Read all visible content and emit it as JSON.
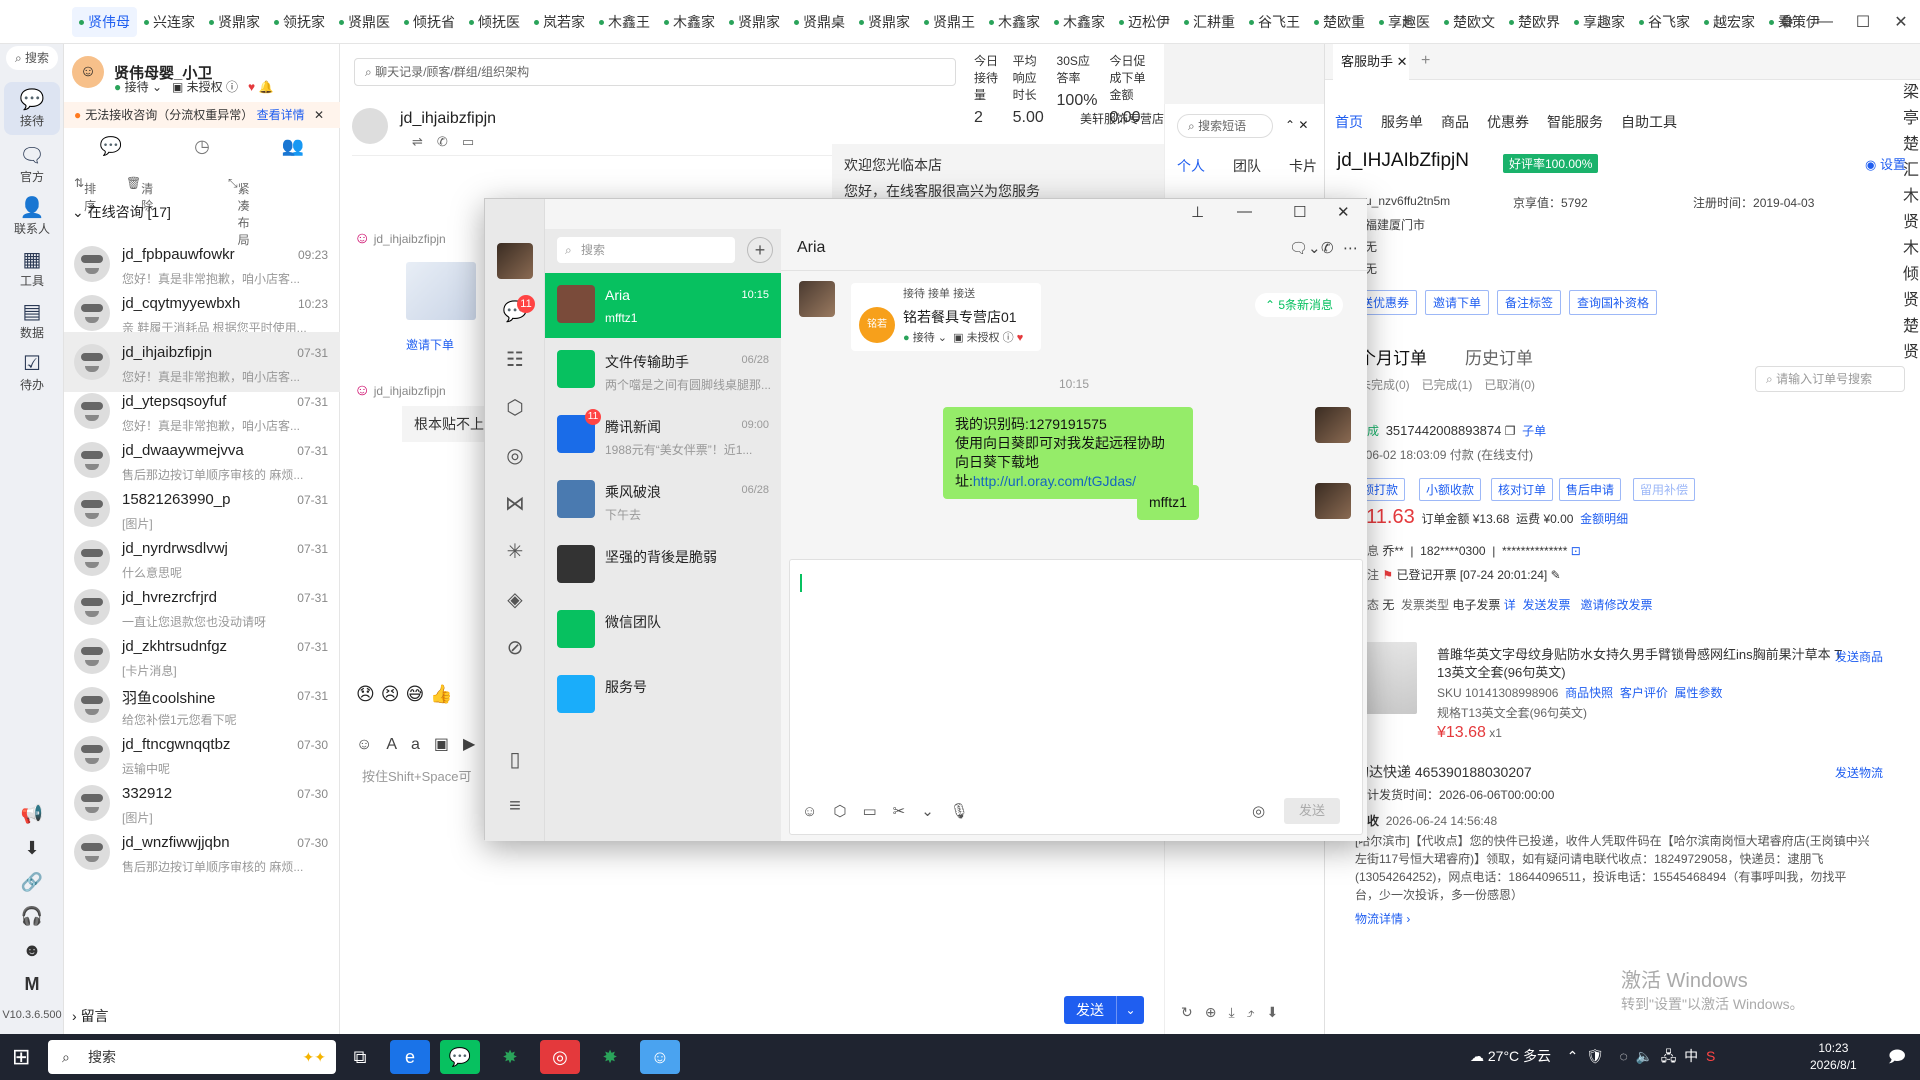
{
  "top_tabs": [
    "贤伟母",
    "兴连家",
    "贤鼎家",
    "领抚家",
    "贤鼎医",
    "倾抚省",
    "倾抚医",
    "岚若家",
    "木鑫王",
    "木鑫家",
    "贤鼎家",
    "贤鼎桌",
    "贤鼎家",
    "贤鼎王",
    "木鑫家",
    "木鑫家",
    "迈松伊",
    "汇耕重",
    "谷飞王",
    "楚欧重",
    "享趣医",
    "楚欧文",
    "楚欧界",
    "享趣家",
    "谷飞家",
    "越宏家",
    "秉策伊"
  ],
  "rail": {
    "search": "搜索",
    "items": [
      "接待",
      "官方",
      "联系人",
      "工具",
      "数据",
      "待办"
    ],
    "version": "V10.3.6.500"
  },
  "me": {
    "name": "贤伟母婴_小卫",
    "status": "接待",
    "auth": "未授权"
  },
  "warning": {
    "text": "无法接收咨询（分流权重异常）",
    "link": "查看详情"
  },
  "sortbar": {
    "sort": "排序",
    "clear": "清除",
    "layout": "紧凑布局"
  },
  "group_title": "在线咨询 [17]",
  "contacts": [
    {
      "name": "jd_fpbpauwfowkr",
      "time": "09:23",
      "preview": "您好！真是非常抱歉，咱小店客..."
    },
    {
      "name": "jd_cqytmyyewbxh",
      "time": "10:23",
      "preview": "亲 鞋履于消耗品 根据您平时使用..."
    },
    {
      "name": "jd_ihjaibzfipjn",
      "time": "07-31",
      "preview": "您好！真是非常抱歉，咱小店客..."
    },
    {
      "name": "jd_ytepsqsoyfuf",
      "time": "07-31",
      "preview": "您好！真是非常抱歉，咱小店客..."
    },
    {
      "name": "jd_dwaaywmejvva",
      "time": "07-31",
      "preview": "售后那边按订单顺序审核的 麻烦..."
    },
    {
      "name": "15821263990_p",
      "time": "07-31",
      "preview": "[图片]"
    },
    {
      "name": "jd_nyrdrwsdlvwj",
      "time": "07-31",
      "preview": "什么意思呢"
    },
    {
      "name": "jd_hvrezrcfrjrd",
      "time": "07-31",
      "preview": "一直让您退款您也没动请呀"
    },
    {
      "name": "jd_zkhtrsudnfgz",
      "time": "07-31",
      "preview": "[卡片消息]"
    },
    {
      "name": "羽鱼coolshine",
      "time": "07-31",
      "preview": "给您补偿1元您看下呢"
    },
    {
      "name": "jd_ftncgwnqqtbz",
      "time": "07-30",
      "preview": "运输中呢"
    },
    {
      "name": "332912",
      "time": "07-30",
      "preview": "[图片]"
    },
    {
      "name": "jd_wnzfiwwjjqbn",
      "time": "07-30",
      "preview": "售后那边按订单顺序审核的 麻烦..."
    }
  ],
  "liuyan": "留言",
  "chat": {
    "search_placeholder": "聊天记录/顾客/群组/组织架构",
    "stats": [
      {
        "label": "今日接待量",
        "value": "2"
      },
      {
        "label": "平均响应时长",
        "value": "5.00"
      },
      {
        "label": "30S应答率",
        "value": "100%"
      },
      {
        "label": "今日促成下单金额",
        "value": "0.00"
      }
    ],
    "header_name": "jd_ihjaibzfipjn",
    "shop": "美轩服饰专营店",
    "welcome_1": "欢迎您光临本店",
    "welcome_2": "您好，在线客服很高兴为您服务",
    "sender1": "jd_ihjaibzfipjn",
    "invite": "邀请下单",
    "sender2": "jd_ihjaibzfipjn",
    "msg_text": "根本贴不上",
    "input_hint": "按住Shift+Space可",
    "send": "发送"
  },
  "quick": {
    "search": "搜索短语",
    "tabs": [
      "个人",
      "团队",
      "卡片"
    ]
  },
  "wechat": {
    "search": "搜索",
    "chat_badge": "11",
    "title": "Aria",
    "items": [
      {
        "name": "Aria",
        "time": "10:15",
        "preview": "mfftz1",
        "color": "#7a4b3a"
      },
      {
        "name": "文件传输助手",
        "time": "06/28",
        "preview": "两个噹是之间有圆脚线桌腿那...",
        "color": "#07c160"
      },
      {
        "name": "腾讯新闻",
        "time": "09:00",
        "preview": "1988元有“美女伴票”！近1...",
        "color": "#1a6ce8",
        "badge": "11"
      },
      {
        "name": "乘风破浪",
        "time": "06/28",
        "preview": "下午去",
        "color": "#4a7ab0"
      },
      {
        "name": "坚强的背後是脆弱",
        "time": "",
        "preview": "",
        "color": "#333333"
      },
      {
        "name": "微信团队",
        "time": "",
        "preview": "",
        "color": "#07c160"
      },
      {
        "name": "服务号",
        "time": "",
        "preview": "",
        "color": "#1aadfa"
      }
    ],
    "card": {
      "top": "接待  接单  接送",
      "name": "铭若餐具专营店01",
      "status": "接待",
      "auth": "未授权"
    },
    "new_msg": "5条新消息",
    "time": "10:15",
    "bubble1_l1": "我的识别码:1279191575",
    "bubble1_l2": "使用向日葵即可对我发起远程协助",
    "bubble1_l3": "向日葵下载地址:",
    "bubble1_link": "http://url.oray.com/tGJdas/",
    "bubble2": "mfftz1",
    "send": "发送"
  },
  "right": {
    "tab": "客服助手",
    "nav": [
      "首页",
      "服务单",
      "商品",
      "优惠券",
      "智能服务",
      "自助工具"
    ],
    "uid": "jd_IHJAIbZfipjN",
    "good": "好评率100.00%",
    "settings": "设置",
    "u_label": "u_nzv6ffu2tn5m",
    "score_label": "京享值：",
    "score": "5792",
    "reg_label": "注册时间：",
    "reg": "2019-04-03",
    "city": "福建厦门市",
    "none1": "无",
    "none2": "无",
    "btns": [
      "送优惠券",
      "邀请下单",
      "备注标签",
      "查询国补资格"
    ],
    "order_tab": "个月订单",
    "history_tab": "历史订单",
    "order_search": "请输入订单号搜索",
    "order_filters": [
      "未完成(0)",
      "已完成(1)",
      "已取消(0)"
    ],
    "order_status": "完成",
    "order_no": "3517442008893874",
    "sub": "子单",
    "order_time": "6-06-02 18:03:09",
    "pay": "付款",
    "online": "(在线支付)",
    "act_btns": [
      "额打款",
      "小额收款",
      "核对订单",
      "售后申请",
      "留用补偿"
    ],
    "price": "¥11.63",
    "amount_label": "订单金额",
    "amount": "¥13.68",
    "freight_label": "运费",
    "freight": "¥0.00",
    "amount_detail": "金额明细",
    "buyer_label": "信息",
    "buyer": "乔**",
    "phone": "182****0300",
    "addr_mask": "**************",
    "remark_label": "备注",
    "remark": "已登记开票",
    "remark_time": "[07-24 20:01:24]",
    "inv_state_label": "状态",
    "inv_state": "无",
    "inv_type_label": "发票类型",
    "inv_type": "电子发票",
    "inv_detail": "详",
    "send_inv": "发送发票",
    "change_inv": "邀请修改发票",
    "product": "普雎华英文字母纹身贴防水女持久男手臂锁骨感网红ins胸前果汁草本 T",
    "product2": "13英文全套(96句英文)",
    "send_product": "发送商品",
    "sku": "SKU 10141308998906",
    "snap": "商品快照",
    "review": "客户评价",
    "attr": "属性参数",
    "spec": "规格T13英文全套(96句英文)",
    "unit_price": "¥13.68",
    "qty": "x1",
    "express": "韵达快递 465390188030207",
    "send_logi": "发送物流",
    "ship_time": "预计发货时间：2026-06-06T00:00:00",
    "sign": "签收",
    "sign_time": "2026-06-24 14:56:48",
    "logi1": "[哈尔滨市]【代收点】您的快件已投递，收件人凭取件码在【哈尔滨南岗恒大珺睿府店(王岗镇中兴",
    "logi2": "左街117号恒大珺睿府)】领取，如有疑问请电联代收点：18249729058，快递员：逮朋飞",
    "logi3": "(13054264252)，网点电话：18644096511，投诉电话：15545468494（有事呼叫我，勿找平",
    "logi4": "台，少一次投诉，多一份感恩）",
    "logi_detail": "物流详情 ›",
    "wm1": "激活 Windows",
    "wm2": "转到\"设置\"以激活 Windows。",
    "side_chars": "梁亭楚汇木贤木倾贤楚贤"
  },
  "taskbar": {
    "search": "搜索",
    "weather": "27°C 多云",
    "lang": "中",
    "time": "10:23",
    "date": "2026/8/1"
  }
}
